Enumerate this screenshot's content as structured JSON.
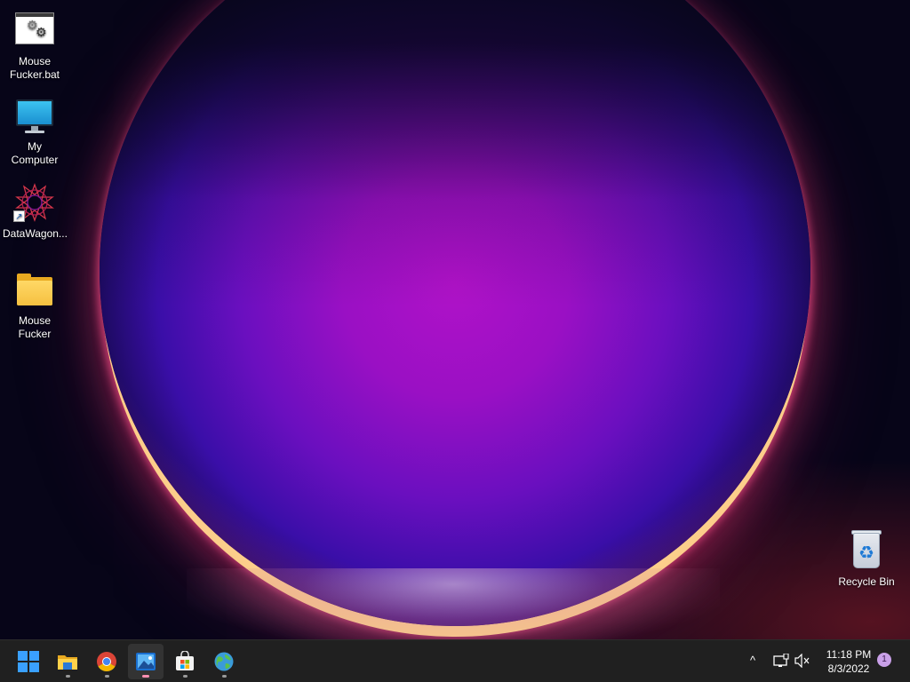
{
  "desktop": {
    "icons": [
      {
        "label": "Mouse Fucker.bat",
        "icon": "batch-file-icon"
      },
      {
        "label": "My Computer",
        "icon": "monitor-icon"
      },
      {
        "label": "DataWagon...",
        "icon": "datawagon-icon"
      },
      {
        "label": "Mouse Fucker",
        "icon": "folder-icon"
      },
      {
        "label": "Recycle Bin",
        "icon": "recycle-bin-icon"
      }
    ],
    "wallpaper_colors": {
      "sky": "#070518",
      "orb": "#b012c8",
      "rim": "#ffd68c"
    }
  },
  "taskbar": {
    "apps": [
      {
        "name": "start-button",
        "icon": "windows-logo-icon"
      },
      {
        "name": "file-explorer",
        "icon": "folder-icon",
        "running": true
      },
      {
        "name": "chrome",
        "icon": "chrome-icon",
        "running": true
      },
      {
        "name": "photos",
        "icon": "photos-icon",
        "running": true,
        "active": true
      },
      {
        "name": "microsoft-store",
        "icon": "store-icon",
        "running": true
      },
      {
        "name": "globe-app",
        "icon": "globe-icon",
        "running": true
      }
    ],
    "tray": {
      "overflow": "^",
      "network": "network-icon",
      "volume": "volume-muted-icon",
      "time": "11:18 PM",
      "date": "8/3/2022",
      "notifications": "1"
    },
    "colors": {
      "background": "#202020",
      "accent": "#3aa0ff",
      "active_indicator": "#ff8fb2"
    }
  }
}
